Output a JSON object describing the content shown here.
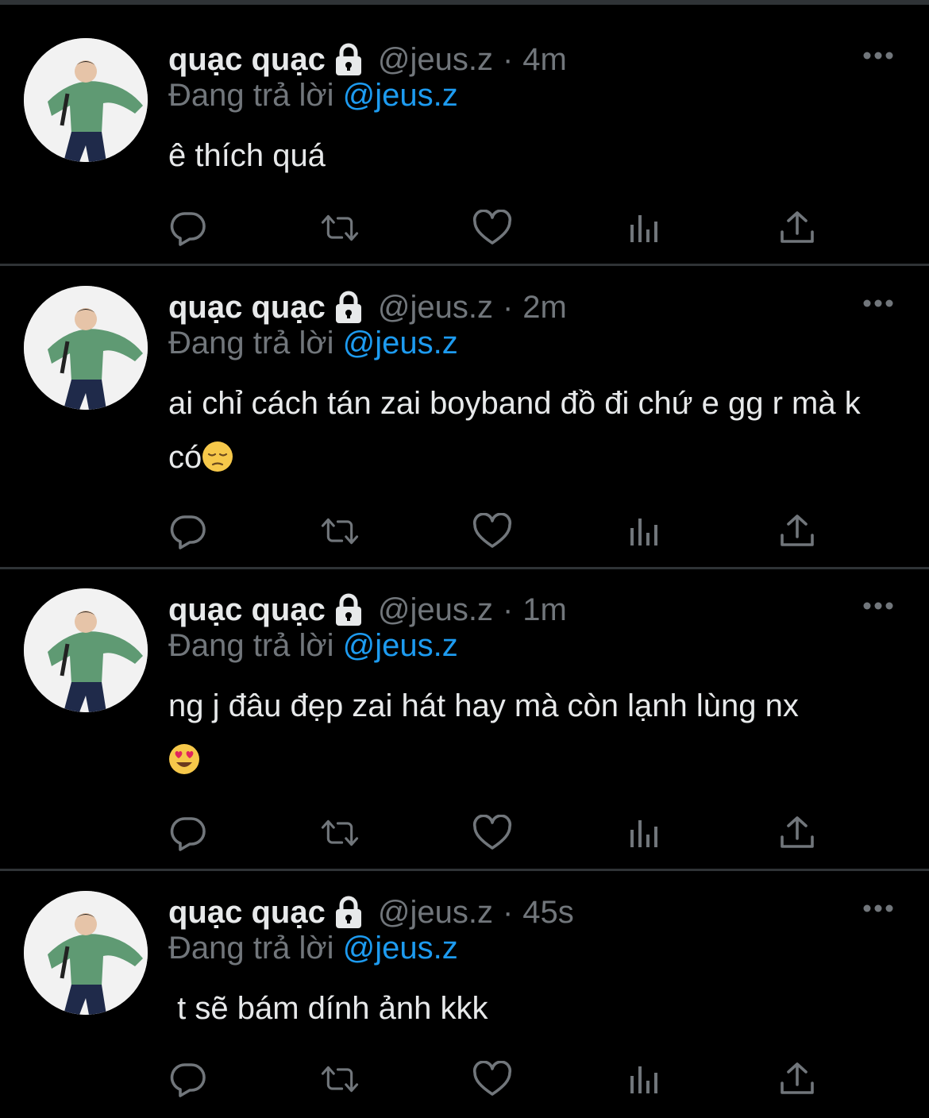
{
  "colors": {
    "background": "#000000",
    "divider": "#2f3336",
    "primary_text": "#e7e9ea",
    "secondary_text": "#71767b",
    "link": "#1d9bf0"
  },
  "icons": [
    "lock-icon",
    "more-icon",
    "reply-icon",
    "retweet-icon",
    "like-icon",
    "analytics-icon",
    "share-icon"
  ],
  "tweets": [
    {
      "display_name": "quạc quạc",
      "handle": "@jeus.z",
      "separator": "·",
      "time": "4m",
      "replying_label": "Đang trả lời",
      "replying_to": "@jeus.z",
      "text": "ê thích quá",
      "emoji": ""
    },
    {
      "display_name": "quạc quạc",
      "handle": "@jeus.z",
      "separator": "·",
      "time": "2m",
      "replying_label": "Đang trả lời",
      "replying_to": "@jeus.z",
      "text": "ai chỉ cách tán zai boyband đồ đi chứ e gg r mà k có",
      "emoji": "pensive-face-emoji"
    },
    {
      "display_name": "quạc quạc",
      "handle": "@jeus.z",
      "separator": "·",
      "time": "1m",
      "replying_label": "Đang trả lời",
      "replying_to": "@jeus.z",
      "text": "ng j đâu đẹp zai hát hay mà còn lạnh lùng nx",
      "emoji": "heart-eyes-emoji"
    },
    {
      "display_name": "quạc quạc",
      "handle": "@jeus.z",
      "separator": "·",
      "time": "45s",
      "replying_label": "Đang trả lời",
      "replying_to": "@jeus.z",
      "text": " t sẽ bám dính ảnh kkk",
      "emoji": ""
    }
  ]
}
